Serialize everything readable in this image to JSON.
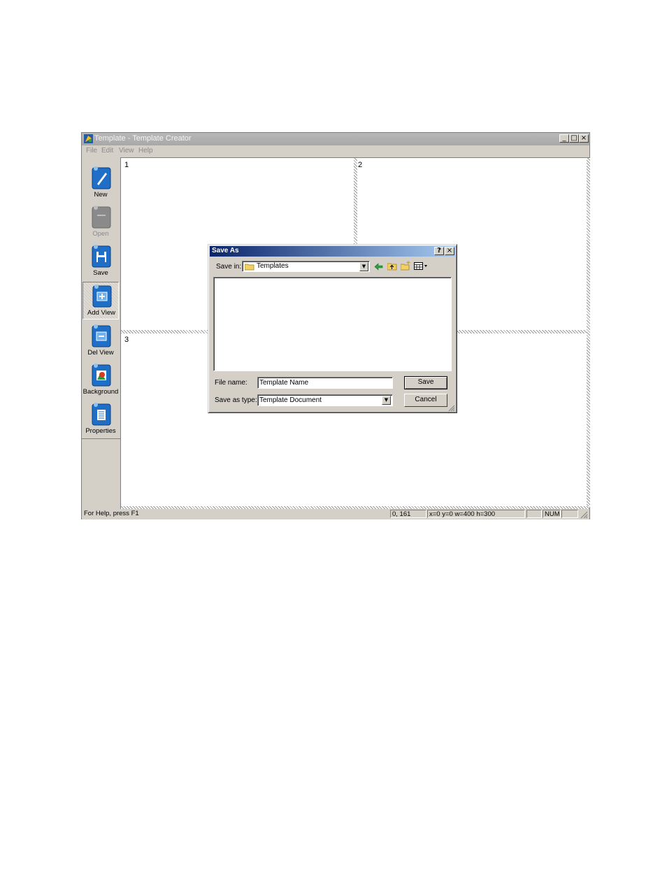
{
  "window": {
    "title": "Template - Template Creator",
    "minimize": "_",
    "maximize": "□",
    "close": "×"
  },
  "menu": [
    "File",
    "Edit",
    "View",
    "Help"
  ],
  "toolbar": [
    {
      "label": "New",
      "icon": "new-document-icon",
      "enabled": true
    },
    {
      "label": "Open",
      "icon": "open-folder-icon",
      "enabled": false
    },
    {
      "label": "Save",
      "icon": "save-disk-icon",
      "enabled": true
    },
    {
      "label": "Add View",
      "icon": "add-view-icon",
      "enabled": true,
      "selected": true
    },
    {
      "label": "Del View",
      "icon": "delete-view-icon",
      "enabled": true
    },
    {
      "label": "Background",
      "icon": "background-icon",
      "enabled": true
    },
    {
      "label": "Properties",
      "icon": "properties-icon",
      "enabled": true
    }
  ],
  "views": [
    "1",
    "2",
    "3"
  ],
  "status": {
    "help": "For Help, press F1",
    "coords": "0, 161",
    "rect": "x=0 y=0 w=400 h=300",
    "num": "NUM"
  },
  "dialog": {
    "title": "Save As",
    "help_btn": "?",
    "close_btn": "×",
    "save_in_label": "Save in:",
    "save_in_value": "Templates",
    "file_name_label": "File name:",
    "file_name_value": "Template Name",
    "save_as_type_label": "Save as type:",
    "save_as_type_value": "Template Document",
    "save_button": "Save",
    "cancel_button": "Cancel"
  },
  "colors": {
    "dialog_title_start": "#0a246a",
    "dialog_title_end": "#a6caf0",
    "window_face": "#d4d0c8",
    "icon_blue": "#1f6fc8"
  }
}
